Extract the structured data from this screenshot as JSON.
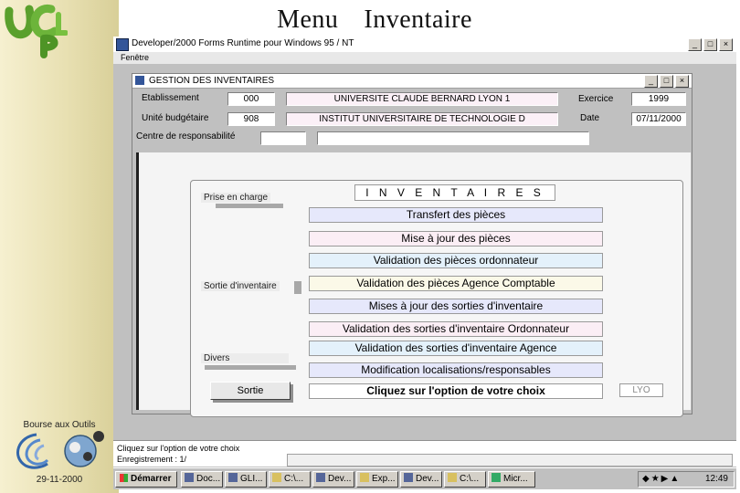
{
  "slide": {
    "title_left": "Menu",
    "title_right": "Inventaire",
    "sidebar_caption": "Bourse aux Outils",
    "sidebar_date": "29-11-2000"
  },
  "app": {
    "title": "Developer/2000 Forms Runtime pour Windows 95 / NT",
    "menu": [
      "Fenêtre"
    ],
    "window_buttons": [
      "_",
      "□",
      "×"
    ]
  },
  "form": {
    "title": "GESTION DES INVENTAIRES",
    "etablissement": {
      "label": "Etablissement",
      "code": "000",
      "name": "UNIVERSITE CLAUDE BERNARD LYON 1"
    },
    "unite": {
      "label": "Unité budgétaire",
      "code": "908",
      "name": "INSTITUT UNIVERSITAIRE DE TECHNOLOGIE D"
    },
    "centre": {
      "label": "Centre de responsabilité",
      "code": "",
      "name": ""
    },
    "exercice": {
      "label": "Exercice",
      "value": "1999"
    },
    "date": {
      "label": "Date",
      "value": "07/11/2000"
    }
  },
  "inventaires": {
    "title": "I N V E N T A I R E S",
    "sections": {
      "prise": "Prise en charge",
      "sortie": "Sortie d'inventaire",
      "divers": "Divers"
    },
    "options": [
      "Transfert des pièces",
      "Mise à jour des pièces",
      "Validation des pièces ordonnateur",
      "Validation des pièces Agence Comptable",
      "Mises à jour des sorties d'inventaire",
      "Validation des sorties d'inventaire Ordonnateur",
      "Validation des sorties d'inventaire Agence",
      "Modification localisations/responsables"
    ],
    "prompt": "Cliquez sur l'option de votre choix",
    "sortie_button": "Sortie",
    "site_code": "LYO"
  },
  "status": {
    "line1": "Cliquez sur l'option de votre choix",
    "line2": "Enregistrement : 1/"
  },
  "taskbar": {
    "start": "Démarrer",
    "tasks": [
      "Doc...",
      "GLI...",
      "C:\\...",
      "Dev...",
      "Exp...",
      "Dev...",
      "C:\\...",
      "Micr..."
    ],
    "clock": "12:49"
  }
}
